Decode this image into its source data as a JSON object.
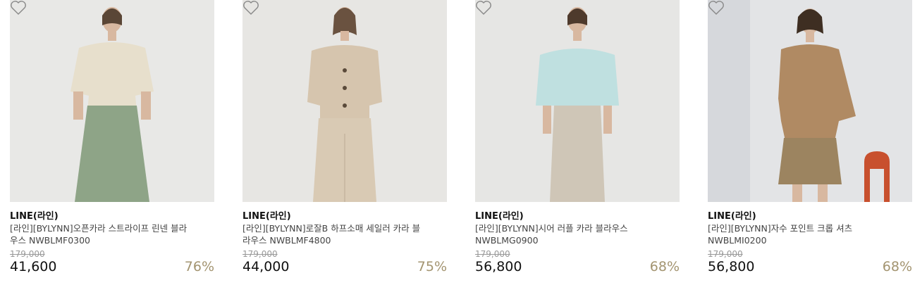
{
  "products": [
    {
      "brand": "LINE(라인)",
      "name": "[라인][BYLYNN]오픈카라 스트라이프 린넨 블라우스 NWBLMF0300",
      "original_price": "179,000",
      "price": "41,600",
      "discount": "76%",
      "top_color": "#e7dfcc",
      "bottom_color": "#8ea487",
      "bg_color": "#e8e8e6",
      "icon": "heart-outline-icon"
    },
    {
      "brand": "LINE(라인)",
      "name": "[라인][BYLYNN]로잘B 하프소매 세일러 카라 블라우스 NWBLMF4800",
      "original_price": "179,000",
      "price": "44,000",
      "discount": "75%",
      "top_color": "#d6c5ae",
      "bottom_color": "#d9cab4",
      "bg_color": "#e7e6e3",
      "icon": "heart-outline-icon"
    },
    {
      "brand": "LINE(라인)",
      "name": "[라인][BYLYNN]시어 러플 카라 블라우스 NWBLMG0900",
      "original_price": "179,000",
      "price": "56,800",
      "discount": "68%",
      "top_color": "#bfe0e0",
      "bottom_color": "#cfc6b7",
      "bg_color": "#e6e6e4",
      "icon": "heart-outline-icon"
    },
    {
      "brand": "LINE(라인)",
      "name": "[라인][BYLYNN]자수 포인트 크롭 셔츠 NWBLMI0200",
      "original_price": "179,000",
      "price": "56,800",
      "discount": "68%",
      "top_color": "#b08a63",
      "bottom_color": "#9c8460",
      "bg_color": "#e3e4e6",
      "icon": "heart-outline-icon"
    }
  ]
}
